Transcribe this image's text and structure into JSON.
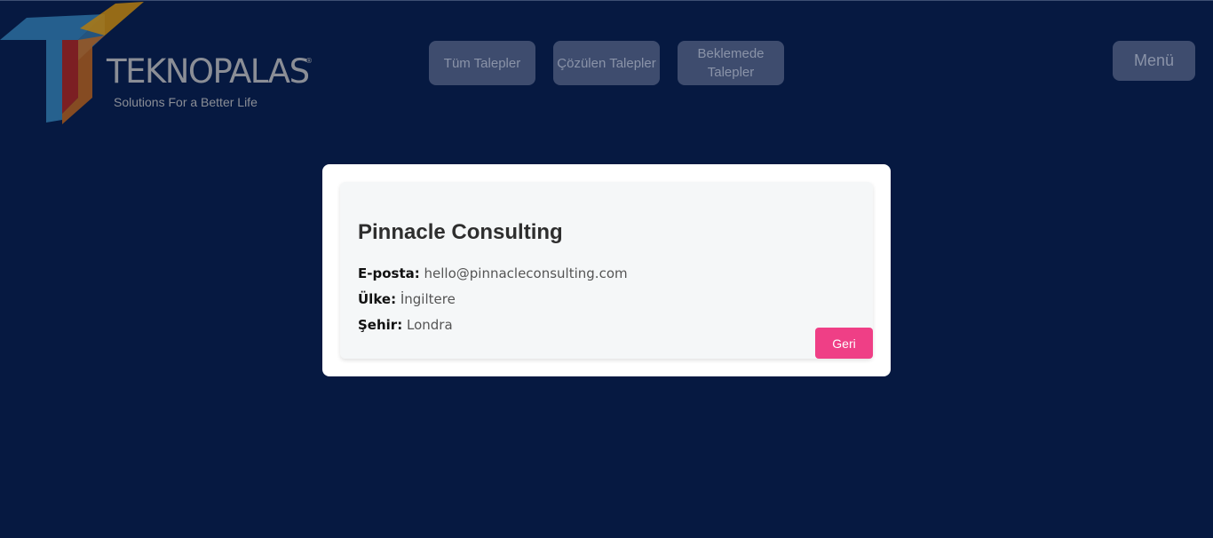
{
  "brand": {
    "name": "TEKNOPALAS",
    "registered": "®",
    "tagline": "Solutions For a Better Life"
  },
  "nav": {
    "all_requests": "Tüm Talepler",
    "solved_requests": "Çözülen Talepler",
    "pending_requests": "Beklemede Talepler",
    "menu": "Menü"
  },
  "detail": {
    "company_name": "Pinnacle Consulting",
    "email_label": "E-posta:",
    "email_value": "hello@pinnacleconsulting.com",
    "country_label": "Ülke:",
    "country_value": "İngiltere",
    "city_label": "Şehir:",
    "city_value": "Londra",
    "back_label": "Geri"
  },
  "colors": {
    "background": "#061941",
    "nav_button": "#3e4c6e",
    "back_button": "#ef3f86",
    "card": "#ffffff"
  }
}
